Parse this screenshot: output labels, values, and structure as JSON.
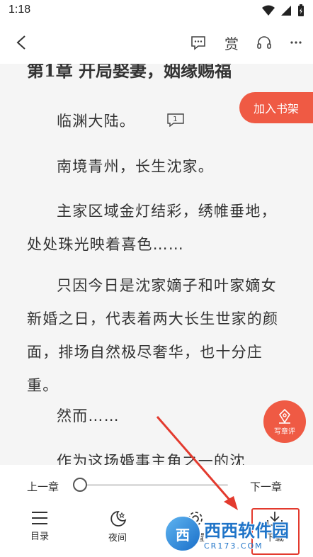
{
  "status": {
    "time": "1:18"
  },
  "reader": {
    "chapter_title": "第1章 开局娶妻，姻缘赐福",
    "paragraphs": [
      "临渊大陆。",
      "南境青州，长生沈家。",
      "主家区域金灯结彩，绣帷垂地，处处珠光映着喜色……",
      "只因今日是沈家嫡子和叶家嫡女新婚之日，代表着两大长生世家的颜面，排场自然极尽奢华，也十分庄重。",
      "然而……",
      "作为这场婚事主角之一的沈"
    ],
    "paragraph_comment_count": "1",
    "add_shelf_label": "加入书架",
    "write_review_label": "写章评"
  },
  "toolbar": {
    "reward_label": "赏"
  },
  "progress": {
    "prev_label": "上一章",
    "next_label": "下一章",
    "value": 0
  },
  "tabs": [
    {
      "label": "目录",
      "icon": "list-icon"
    },
    {
      "label": "夜间",
      "icon": "moon-icon"
    },
    {
      "label": "设置",
      "icon": "gear-icon"
    },
    {
      "label": "下载",
      "icon": "download-icon"
    }
  ],
  "watermark": {
    "main": "西西软件园",
    "sub": "CR173.COM",
    "logo": "西"
  },
  "colors": {
    "accent": "#ef5a44",
    "highlight": "#e33a2e"
  }
}
